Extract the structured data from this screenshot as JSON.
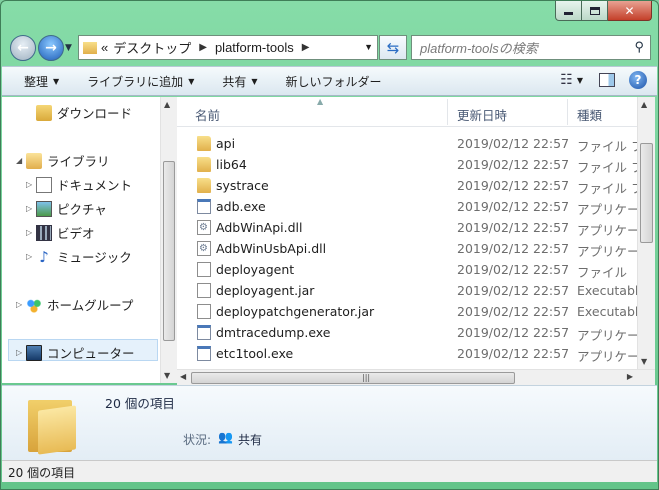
{
  "address": {
    "history_glyph": "«",
    "crumbs": [
      "デスクトップ",
      "platform-tools"
    ]
  },
  "search": {
    "placeholder": "platform-toolsの検索"
  },
  "toolbar": {
    "organize": "整理",
    "add_to_library": "ライブラリに追加",
    "share": "共有",
    "new_folder": "新しいフォルダー"
  },
  "navpane": {
    "downloads": "ダウンロード",
    "libraries": "ライブラリ",
    "documents": "ドキュメント",
    "pictures": "ピクチャ",
    "videos": "ビデオ",
    "music": "ミュージック",
    "homegroup": "ホームグループ",
    "computer": "コンピューター"
  },
  "columns": {
    "name": "名前",
    "date": "更新日時",
    "type": "種類"
  },
  "files": [
    {
      "name": "api",
      "date": "2019/02/12 22:57",
      "type": "ファイル フ",
      "icon": "folder"
    },
    {
      "name": "lib64",
      "date": "2019/02/12 22:57",
      "type": "ファイル フ",
      "icon": "folder"
    },
    {
      "name": "systrace",
      "date": "2019/02/12 22:57",
      "type": "ファイル フ",
      "icon": "folder"
    },
    {
      "name": "adb.exe",
      "date": "2019/02/12 22:57",
      "type": "アプリケー",
      "icon": "exe"
    },
    {
      "name": "AdbWinApi.dll",
      "date": "2019/02/12 22:57",
      "type": "アプリケー",
      "icon": "dll"
    },
    {
      "name": "AdbWinUsbApi.dll",
      "date": "2019/02/12 22:57",
      "type": "アプリケー",
      "icon": "dll"
    },
    {
      "name": "deployagent",
      "date": "2019/02/12 22:57",
      "type": "ファイル",
      "icon": "file"
    },
    {
      "name": "deployagent.jar",
      "date": "2019/02/12 22:57",
      "type": "Executable",
      "icon": "jar"
    },
    {
      "name": "deploypatchgenerator.jar",
      "date": "2019/02/12 22:57",
      "type": "Executable",
      "icon": "jar"
    },
    {
      "name": "dmtracedump.exe",
      "date": "2019/02/12 22:57",
      "type": "アプリケー",
      "icon": "exe"
    },
    {
      "name": "etc1tool.exe",
      "date": "2019/02/12 22:57",
      "type": "アプリケー",
      "icon": "exe"
    }
  ],
  "details": {
    "item_count": "20 個の項目",
    "status_label": "状況:",
    "status_value": "共有"
  },
  "statusbar": {
    "text": "20 個の項目"
  }
}
